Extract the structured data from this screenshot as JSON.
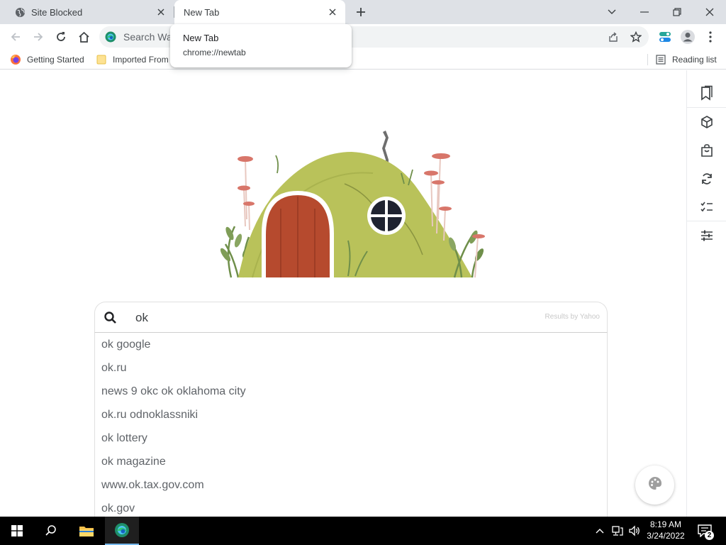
{
  "browser": {
    "tabs": [
      {
        "title": "Site Blocked",
        "favicon": "globe-icon",
        "active": false
      },
      {
        "title": "New Tab",
        "favicon": "",
        "active": true
      }
    ],
    "tooltip": {
      "title": "New Tab",
      "url": "chrome://newtab"
    },
    "omnibox": {
      "placeholder": "Search Wa",
      "icon": "edge-icon"
    },
    "bookmarks": [
      {
        "label": "Getting Started",
        "icon": "firefox-icon"
      },
      {
        "label": "Imported From",
        "icon": "folder-icon"
      }
    ],
    "reading_list": "Reading list"
  },
  "newtab": {
    "search_value": "ok",
    "results_by": "Results by Yahoo",
    "suggestions": [
      "ok google",
      "ok.ru",
      "news 9 okc ok oklahoma city",
      "ok.ru odnoklassniki",
      "ok lottery",
      "ok magazine",
      "www.ok.tax.gov.com",
      "ok.gov"
    ]
  },
  "sidebar": {
    "items": [
      "bookmark-icon",
      "cube-icon",
      "shopping-bag-icon",
      "refresh-icon",
      "checklist-icon",
      "sliders-icon"
    ]
  },
  "taskbar": {
    "time": "8:19 AM",
    "date": "3/24/2022",
    "notifications": "2"
  },
  "colors": {
    "tabstrip": "#dee1e6",
    "door": "#b64a2e",
    "hill": "#b9c25a",
    "taskbar": "#000000",
    "accent": "#76b9ed"
  }
}
